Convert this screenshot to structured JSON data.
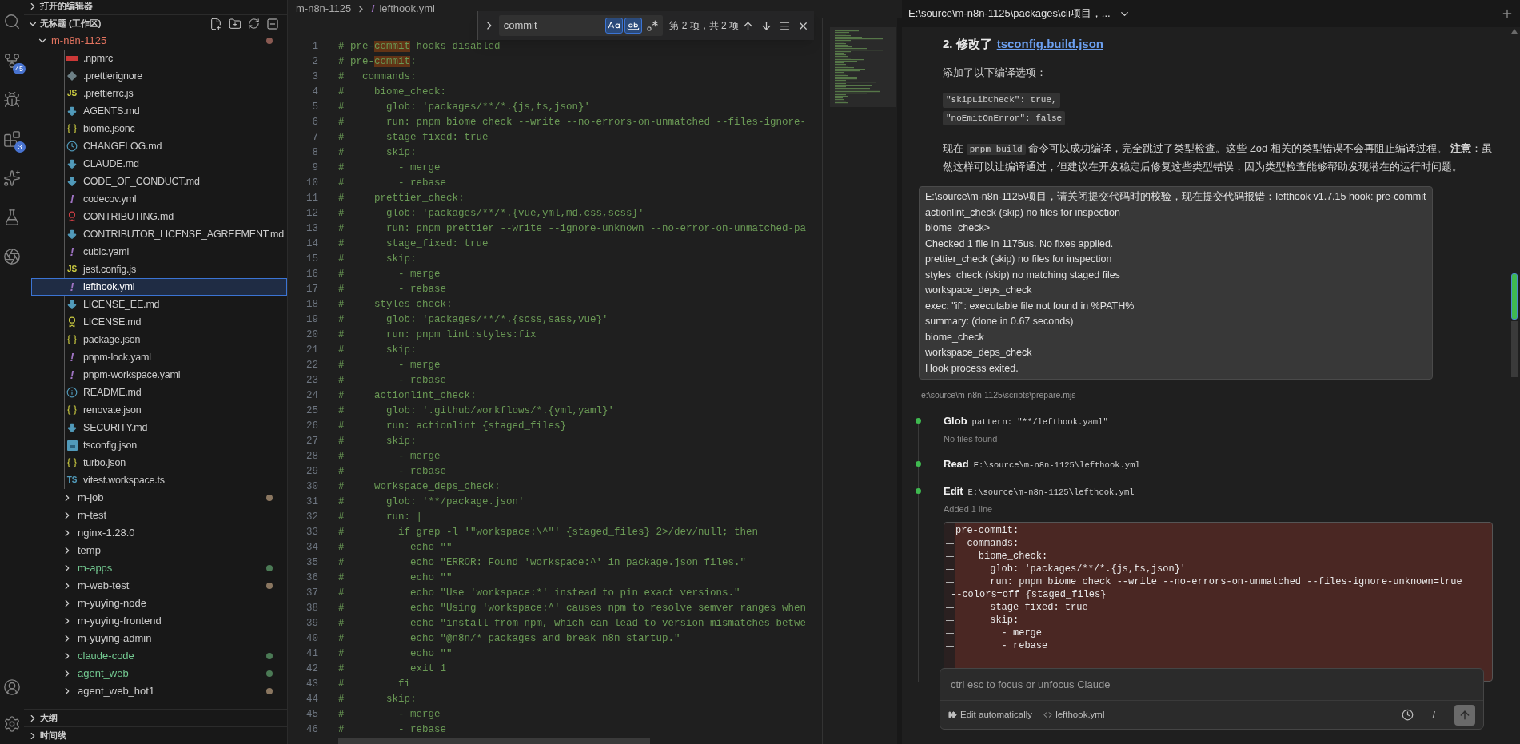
{
  "activity_bar": {
    "source_control_badge": "45",
    "extensions_badge": "3"
  },
  "sidebar": {
    "open_editors": {
      "title": "打开的编辑器",
      "expanded": false
    },
    "workspace": {
      "title": "无标题 (工作区)",
      "expanded": true,
      "root": {
        "name": "m-n8n-1125",
        "expanded": true,
        "conflict": true,
        "color": "#8a5a52",
        "files": [
          {
            "name": ".npmrc",
            "kind": "npm",
            "selected": false
          },
          {
            "name": ".prettierignore",
            "kind": "diamond",
            "selected": false
          },
          {
            "name": ".prettierrc.js",
            "kind": "js",
            "icon_label": "JS",
            "selected": false
          },
          {
            "name": "AGENTS.md",
            "kind": "md",
            "selected": false
          },
          {
            "name": "biome.jsonc",
            "kind": "json",
            "selected": false
          },
          {
            "name": "CHANGELOG.md",
            "kind": "changelog",
            "selected": false
          },
          {
            "name": "CLAUDE.md",
            "kind": "md",
            "selected": false
          },
          {
            "name": "CODE_OF_CONDUCT.md",
            "kind": "md",
            "selected": false
          },
          {
            "name": "codecov.yml",
            "kind": "yml",
            "icon_label": "!",
            "selected": false
          },
          {
            "name": "CONTRIBUTING.md",
            "kind": "contributing",
            "selected": false
          },
          {
            "name": "CONTRIBUTOR_LICENSE_AGREEMENT.md",
            "kind": "md",
            "selected": false
          },
          {
            "name": "cubic.yaml",
            "kind": "yml",
            "icon_label": "!",
            "selected": false
          },
          {
            "name": "jest.config.js",
            "kind": "js",
            "icon_label": "JS",
            "selected": false
          },
          {
            "name": "lefthook.yml",
            "kind": "yml",
            "icon_label": "!",
            "selected": true
          },
          {
            "name": "LICENSE_EE.md",
            "kind": "md",
            "selected": false
          },
          {
            "name": "LICENSE.md",
            "kind": "license",
            "selected": false
          },
          {
            "name": "package.json",
            "kind": "json",
            "selected": false
          },
          {
            "name": "pnpm-lock.yaml",
            "kind": "yml",
            "icon_label": "!",
            "selected": false
          },
          {
            "name": "pnpm-workspace.yaml",
            "kind": "yml",
            "icon_label": "!",
            "selected": false
          },
          {
            "name": "README.md",
            "kind": "info",
            "selected": false
          },
          {
            "name": "renovate.json",
            "kind": "json",
            "selected": false
          },
          {
            "name": "SECURITY.md",
            "kind": "md",
            "selected": false
          },
          {
            "name": "tsconfig.json",
            "kind": "tsconfig",
            "selected": false
          },
          {
            "name": "turbo.json",
            "kind": "json",
            "selected": false
          },
          {
            "name": "vitest.workspace.ts",
            "kind": "ts",
            "icon_label": "TS",
            "selected": false
          }
        ]
      },
      "folders": [
        {
          "name": "m-job",
          "expanded": false,
          "untracked": false,
          "color": "#8a7660"
        },
        {
          "name": "m-test",
          "expanded": false,
          "untracked": false
        },
        {
          "name": "nginx-1.28.0",
          "expanded": false,
          "untracked": false
        },
        {
          "name": "temp",
          "expanded": false,
          "untracked": false
        },
        {
          "name": "m-apps",
          "expanded": false,
          "untracked": true,
          "color": "#4b7a55"
        },
        {
          "name": "m-web-test",
          "expanded": false,
          "untracked": false,
          "color": "#8a7660"
        },
        {
          "name": "m-yuying-node",
          "expanded": false,
          "untracked": false
        },
        {
          "name": "m-yuying-frontend",
          "expanded": false,
          "untracked": false
        },
        {
          "name": "m-yuying-admin",
          "expanded": false,
          "untracked": false
        },
        {
          "name": "claude-code",
          "expanded": false,
          "untracked": true,
          "color": "#4b7a55"
        },
        {
          "name": "agent_web",
          "expanded": false,
          "untracked": true,
          "color": "#4b7a55"
        },
        {
          "name": "agent_web_hot1",
          "expanded": false,
          "untracked": false,
          "color": "#8a7660"
        }
      ]
    },
    "outline": {
      "title": "大纲",
      "expanded": false
    },
    "timeline": {
      "title": "时间线",
      "expanded": false
    }
  },
  "editor": {
    "breadcrumb": {
      "folder": "m-n8n-1125",
      "file_icon": "!",
      "file": "lefthook.yml"
    },
    "find": {
      "value": "commit",
      "match_case": true,
      "whole_word": true,
      "regex": false,
      "result": "第 2 项，共 2 项"
    },
    "lines": [
      {
        "number": "1",
        "segments": [
          {
            "text": "# pre-",
            "match": false
          },
          {
            "text": "commit",
            "match": true
          },
          {
            "text": " hooks disabled",
            "match": false
          }
        ]
      },
      {
        "number": "2",
        "segments": [
          {
            "text": "# pre-",
            "match": false
          },
          {
            "text": "commit",
            "match": true
          },
          {
            "text": ":",
            "match": false
          }
        ]
      },
      {
        "number": "3",
        "text": "#   commands:"
      },
      {
        "number": "4",
        "text": "#     biome_check:"
      },
      {
        "number": "5",
        "text": "#       glob: 'packages/**/*.{js,ts,json}'"
      },
      {
        "number": "6",
        "text": "#       run: pnpm biome check --write --no-errors-on-unmatched --files-ignore-"
      },
      {
        "number": "7",
        "text": "#       stage_fixed: true"
      },
      {
        "number": "8",
        "text": "#       skip:"
      },
      {
        "number": "9",
        "text": "#         - merge"
      },
      {
        "number": "10",
        "text": "#         - rebase"
      },
      {
        "number": "11",
        "text": "#     prettier_check:"
      },
      {
        "number": "12",
        "text": "#       glob: 'packages/**/*.{vue,yml,md,css,scss}'"
      },
      {
        "number": "13",
        "text": "#       run: pnpm prettier --write --ignore-unknown --no-error-on-unmatched-pa"
      },
      {
        "number": "14",
        "text": "#       stage_fixed: true"
      },
      {
        "number": "15",
        "text": "#       skip:"
      },
      {
        "number": "16",
        "text": "#         - merge"
      },
      {
        "number": "17",
        "text": "#         - rebase"
      },
      {
        "number": "18",
        "text": "#     styles_check:"
      },
      {
        "number": "19",
        "text": "#       glob: 'packages/**/*.{scss,sass,vue}'"
      },
      {
        "number": "20",
        "text": "#       run: pnpm lint:styles:fix"
      },
      {
        "number": "21",
        "text": "#       skip:"
      },
      {
        "number": "22",
        "text": "#         - merge"
      },
      {
        "number": "23",
        "text": "#         - rebase"
      },
      {
        "number": "24",
        "text": "#     actionlint_check:"
      },
      {
        "number": "25",
        "text": "#       glob: '.github/workflows/*.{yml,yaml}'"
      },
      {
        "number": "26",
        "text": "#       run: actionlint {staged_files}"
      },
      {
        "number": "27",
        "text": "#       skip:"
      },
      {
        "number": "28",
        "text": "#         - merge"
      },
      {
        "number": "29",
        "text": "#         - rebase"
      },
      {
        "number": "30",
        "text": "#     workspace_deps_check:"
      },
      {
        "number": "31",
        "text": "#       glob: '**/package.json'"
      },
      {
        "number": "32",
        "text": "#       run: |"
      },
      {
        "number": "33",
        "text": "#         if grep -l '\"workspace:\\^\"' {staged_files} 2>/dev/null; then"
      },
      {
        "number": "34",
        "text": "#           echo \"\""
      },
      {
        "number": "35",
        "text": "#           echo \"ERROR: Found 'workspace:^' in package.json files.\""
      },
      {
        "number": "36",
        "text": "#           echo \"\""
      },
      {
        "number": "37",
        "text": "#           echo \"Use 'workspace:*' instead to pin exact versions.\""
      },
      {
        "number": "38",
        "text": "#           echo \"Using 'workspace:^' causes npm to resolve semver ranges when"
      },
      {
        "number": "39",
        "text": "#           echo \"install from npm, which can lead to version mismatches betwe"
      },
      {
        "number": "40",
        "text": "#           echo \"@n8n/* packages and break n8n startup.\""
      },
      {
        "number": "41",
        "text": "#           echo \"\""
      },
      {
        "number": "42",
        "text": "#           exit 1"
      },
      {
        "number": "43",
        "text": "#         fi"
      },
      {
        "number": "44",
        "text": "#       skip:"
      },
      {
        "number": "45",
        "text": "#         - merge"
      },
      {
        "number": "46",
        "text": "#         - rebase"
      }
    ]
  },
  "chat": {
    "title": "E:\\source\\m-n8n-1125\\packages\\cli项目，...",
    "heading": {
      "text": "2. 修改了",
      "link": "tsconfig.build.json"
    },
    "intro": "添加了以下编译选项：",
    "code_lines": [
      "\"skipLibCheck\": true,",
      "\"noEmitOnError\": false"
    ],
    "summary": {
      "before": "现在",
      "code": "pnpm build",
      "after": "命令可以成功编译，完全跳过了类型检查。这些 Zod 相关的类型错误不会再阻止编译过程。 **注意**：虽然这样可以让编译通过，但建议在开发稳定后修复这些类型错误，因为类型检查能够帮助发现潜在的运行时问题。"
    },
    "user_message": [
      "E:\\source\\m-n8n-1125\\项目，请关闭提交代码时的校验，现在提交代码报错：lefthook v1.7.15 hook: pre-commit",
      "actionlint_check (skip) no files for inspection",
      "biome_check>",
      "Checked 1 file in 1175us. No fixes applied.",
      "prettier_check (skip) no files for inspection",
      "styles_check (skip) no matching staged files",
      "workspace_deps_check",
      "exec: \"if\": executable file not found in %PATH%",
      "summary: (done in 0.67 seconds)",
      "biome_check",
      "workspace_deps_check",
      "Hook process exited."
    ],
    "path": "e:\\source\\m-n8n-1125\\scripts\\prepare.mjs",
    "tools": [
      {
        "name": "Glob",
        "argument": "pattern: \"**/lefthook.yaml\"",
        "result": "No files found"
      },
      {
        "name": "Read",
        "argument": "E:\\source\\m-n8n-1125\\lefthook.yml"
      },
      {
        "name": "Edit",
        "argument": "E:\\source\\m-n8n-1125\\lefthook.yml",
        "result": "Added 1 line",
        "diff": [
          {
            "text": "pre-commit:",
            "continuation": false
          },
          {
            "text": "  commands:",
            "continuation": false
          },
          {
            "text": "    biome_check:",
            "continuation": false
          },
          {
            "text": "      glob: 'packages/**/*.{js,ts,json}'",
            "continuation": false
          },
          {
            "text": "      run: pnpm biome check --write --no-errors-on-unmatched --files-ignore-unknown=true",
            "continuation": false
          },
          {
            "text": "--colors=off {staged_files}",
            "continuation": true
          },
          {
            "text": "      stage_fixed: true",
            "continuation": false
          },
          {
            "text": "      skip:",
            "continuation": false
          },
          {
            "text": "        - merge",
            "continuation": false
          },
          {
            "text": "        - rebase",
            "continuation": false
          }
        ]
      }
    ],
    "input": {
      "placeholder": "ctrl esc to focus or unfocus Claude",
      "mode": "Edit automatically",
      "file": "lefthook.yml",
      "slash": "/"
    }
  }
}
